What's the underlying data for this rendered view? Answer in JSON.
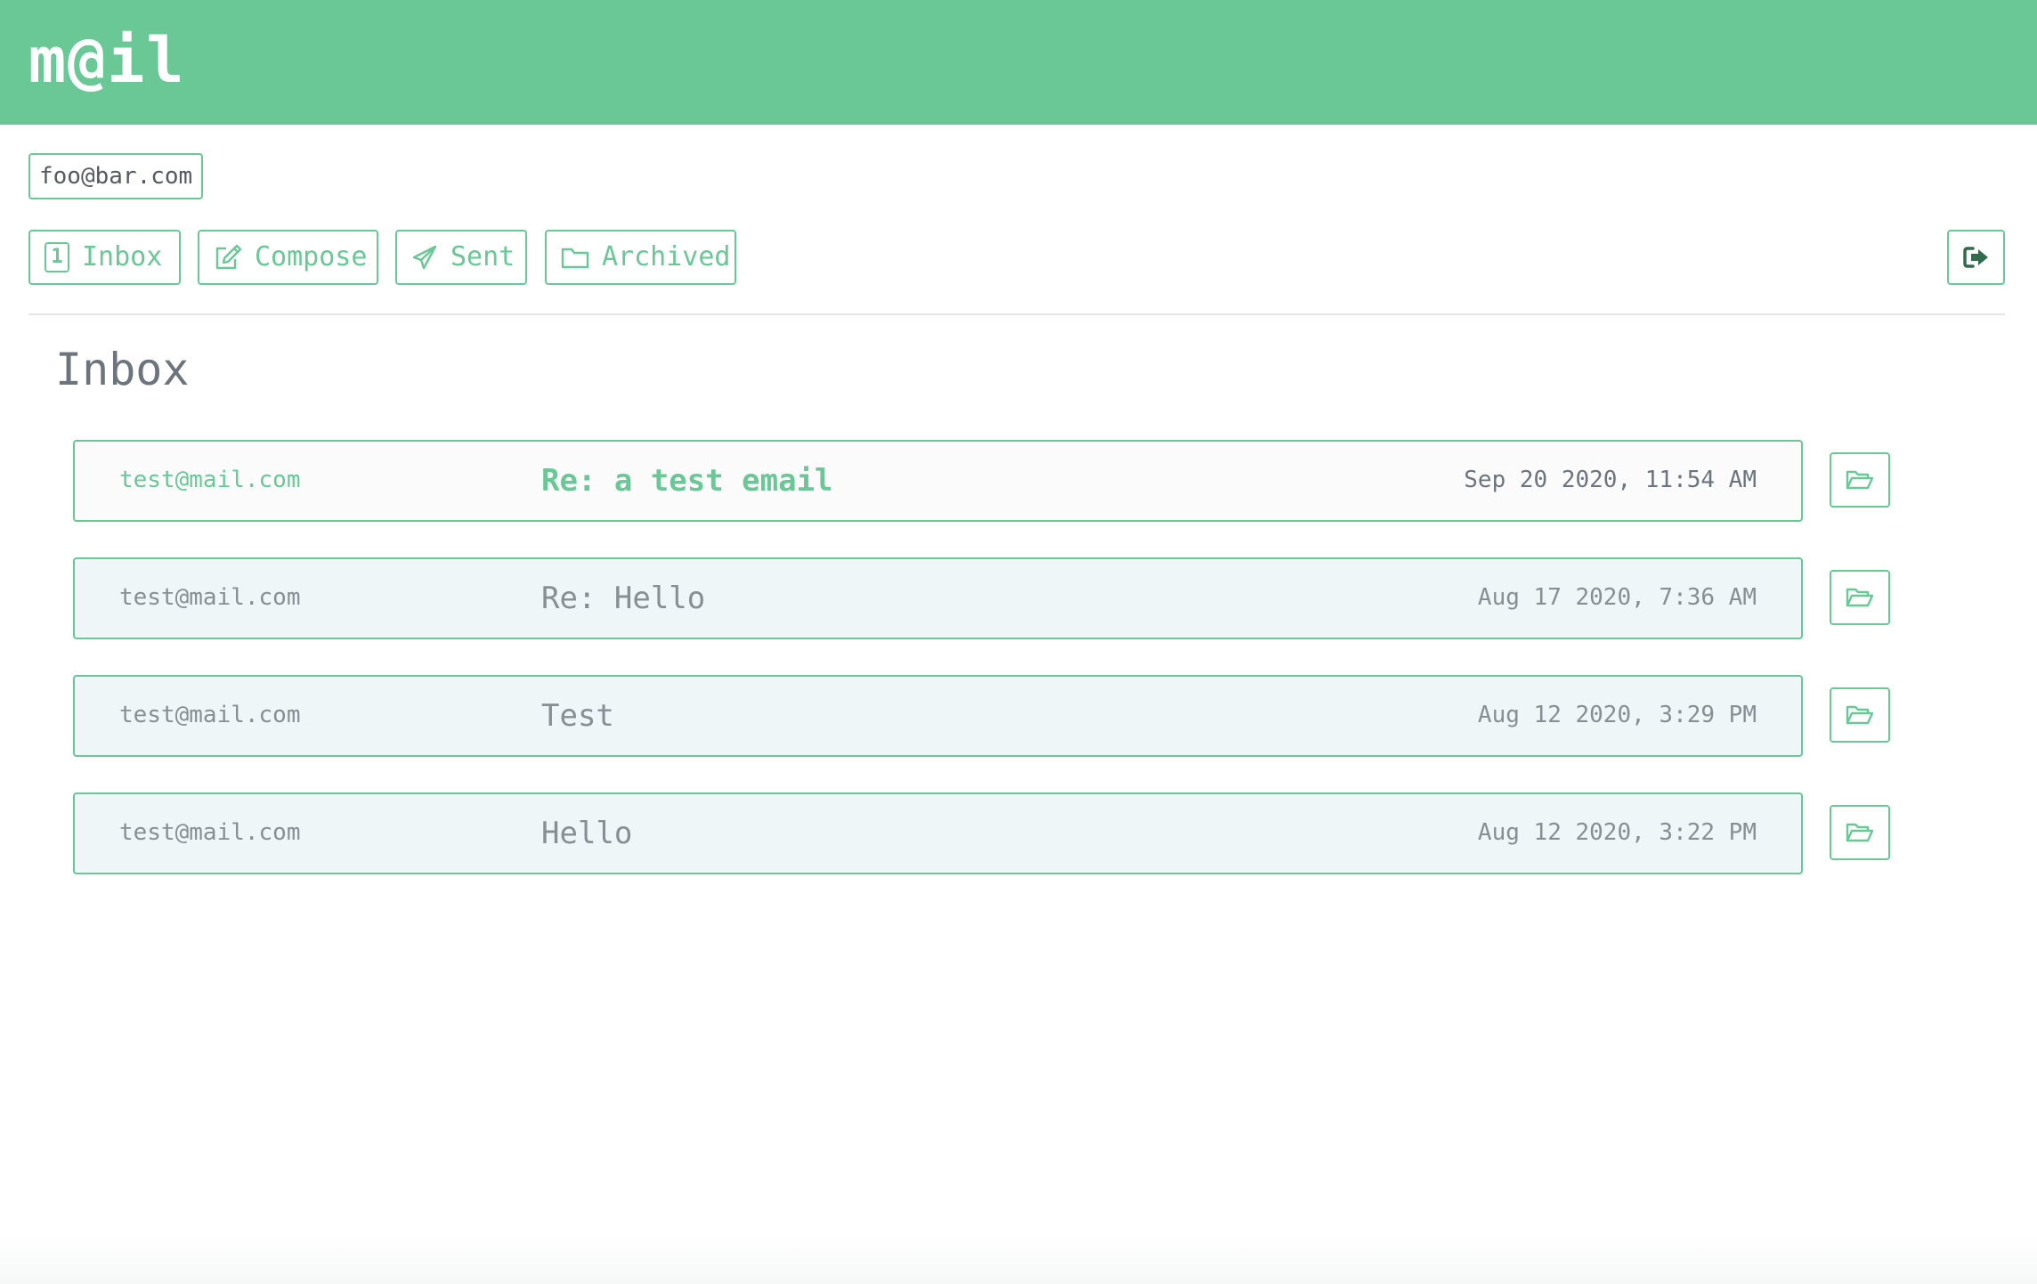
{
  "app": {
    "logo": "m@il"
  },
  "user": {
    "email": "foo@bar.com"
  },
  "nav": {
    "inbox_count": "1",
    "inbox_label": "Inbox",
    "compose_label": "Compose",
    "sent_label": "Sent",
    "archived_label": "Archived",
    "logout_icon": "sign-out-icon"
  },
  "page": {
    "title": "Inbox"
  },
  "emails": [
    {
      "sender": "test@mail.com",
      "subject": "Re: a test email",
      "date": "Sep 20 2020, 11:54 AM",
      "unread": true
    },
    {
      "sender": "test@mail.com",
      "subject": "Re: Hello",
      "date": "Aug 17 2020, 7:36 AM",
      "unread": false
    },
    {
      "sender": "test@mail.com",
      "subject": "Test",
      "date": "Aug 12 2020, 3:29 PM",
      "unread": false
    },
    {
      "sender": "test@mail.com",
      "subject": "Hello",
      "date": "Aug 12 2020, 3:22 PM",
      "unread": false
    }
  ],
  "icons": {
    "archive": "folder-open-icon",
    "compose": "edit-icon",
    "sent": "paper-plane-icon",
    "archived": "folder-icon"
  },
  "colors": {
    "brand": "#69c896",
    "read_row_bg": "#eef6f7",
    "unread_row_bg": "#fbfbfc",
    "muted_text": "#888e94",
    "logout_icon": "#2f6b4c"
  }
}
